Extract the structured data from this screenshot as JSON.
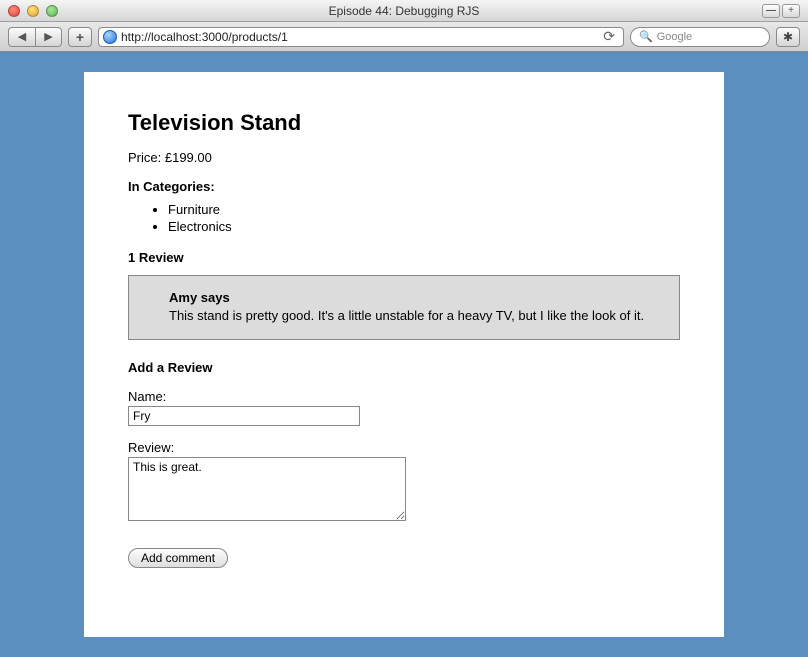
{
  "window": {
    "title": "Episode 44: Debugging RJS"
  },
  "toolbar": {
    "url": "http://localhost:3000/products/1",
    "search_placeholder": "Google"
  },
  "product": {
    "title": "Television Stand",
    "price_label": "Price:",
    "price_value": "£199.00",
    "categories_heading": "In Categories:",
    "categories": [
      "Furniture",
      "Electronics"
    ]
  },
  "reviews": {
    "heading": "1 Review",
    "items": [
      {
        "author_line": "Amy says",
        "body": "This stand is pretty good. It's a little unstable for a heavy TV, but I like the look of it."
      }
    ]
  },
  "form": {
    "heading": "Add a Review",
    "name_label": "Name:",
    "name_value": "Fry",
    "review_label": "Review:",
    "review_value": "This is great.",
    "submit_label": "Add comment"
  }
}
